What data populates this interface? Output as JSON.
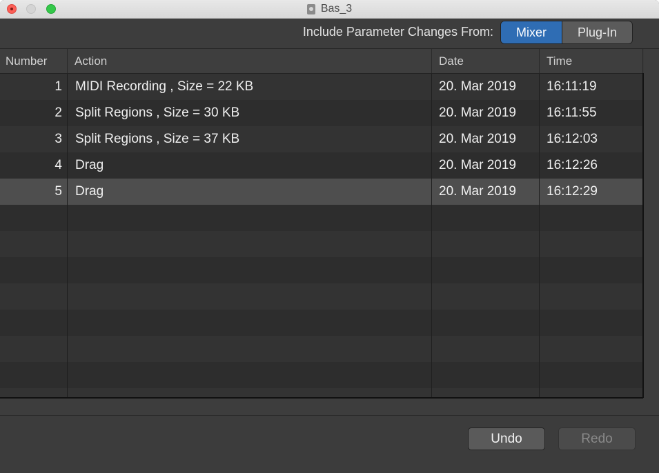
{
  "window": {
    "title": "Bas_3"
  },
  "toolbar": {
    "include_label": "Include Parameter Changes From:",
    "segments": [
      {
        "label": "Mixer",
        "selected": true
      },
      {
        "label": "Plug-In",
        "selected": false
      }
    ]
  },
  "table": {
    "columns": [
      "Number",
      "Action",
      "Date",
      "Time"
    ],
    "rows": [
      {
        "number": "1",
        "action": "MIDI Recording , Size = 22 KB",
        "date": "20. Mar 2019",
        "time": "16:11:19"
      },
      {
        "number": "2",
        "action": "Split Regions , Size = 30 KB",
        "date": "20. Mar 2019",
        "time": "16:11:55"
      },
      {
        "number": "3",
        "action": "Split Regions , Size = 37 KB",
        "date": "20. Mar 2019",
        "time": "16:12:03"
      },
      {
        "number": "4",
        "action": "Drag",
        "date": "20. Mar 2019",
        "time": "16:12:26"
      },
      {
        "number": "5",
        "action": "Drag",
        "date": "20. Mar 2019",
        "time": "16:12:29"
      }
    ],
    "selected_row": 5
  },
  "buttons": {
    "undo": "Undo",
    "redo": "Redo"
  },
  "colors": {
    "accent": "#2f6db4",
    "close": "#fc5f57",
    "zoom": "#34c84a"
  }
}
